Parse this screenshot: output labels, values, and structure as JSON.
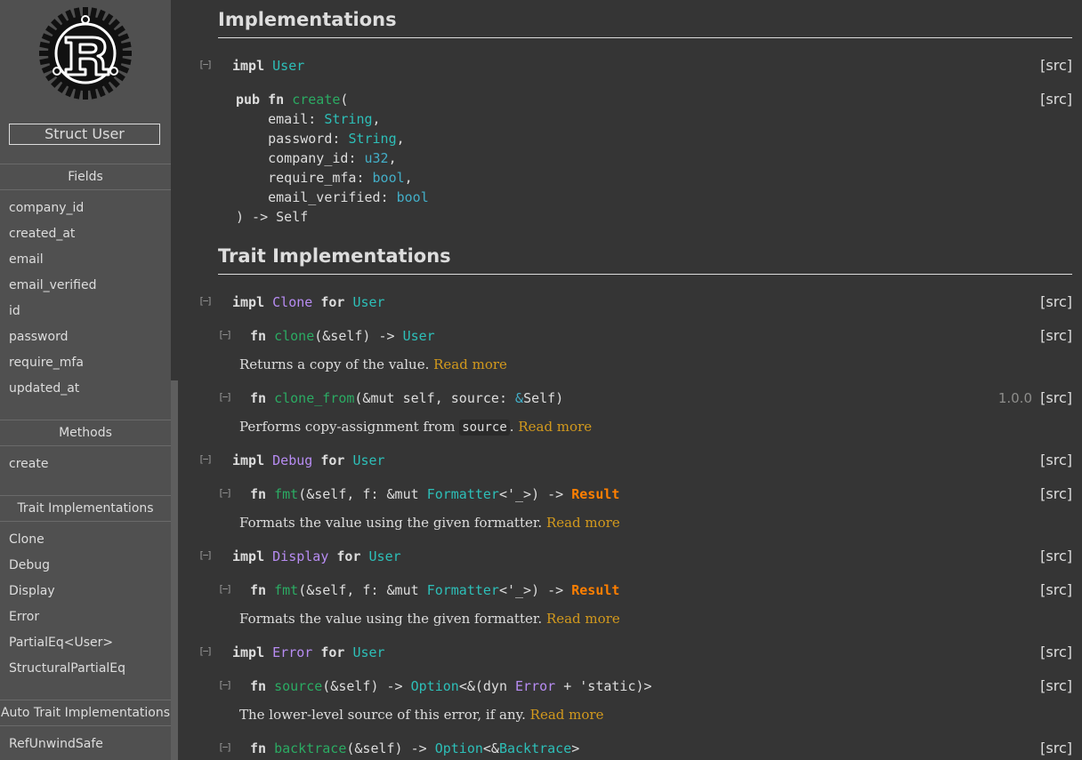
{
  "sidebar": {
    "location": "Struct User",
    "sections": {
      "fields_heading": "Fields",
      "fields": [
        "company_id",
        "created_at",
        "email",
        "email_verified",
        "id",
        "password",
        "require_mfa",
        "updated_at"
      ],
      "methods_heading": "Methods",
      "methods": [
        "create"
      ],
      "trait_impls_heading": "Trait Implementations",
      "trait_impls": [
        "Clone",
        "Debug",
        "Display",
        "Error",
        "PartialEq<User>",
        "StructuralPartialEq"
      ],
      "auto_trait_heading": "Auto Trait Implementations",
      "auto_traits": [
        "RefUnwindSafe"
      ]
    }
  },
  "main": {
    "implementations_heading": "Implementations",
    "trait_impls_heading": "Trait Implementations",
    "src_label": "[src]",
    "impl_user": {
      "kw": "impl",
      "type": "User"
    },
    "create_sig": {
      "pub": "pub",
      "fn": "fn",
      "name": "create",
      "open": "(",
      "params": [
        {
          "name": "email",
          "type": "String"
        },
        {
          "name": "password",
          "type": "String"
        },
        {
          "name": "company_id",
          "type": "u32"
        },
        {
          "name": "require_mfa",
          "type": "bool"
        },
        {
          "name": "email_verified",
          "type": "bool"
        }
      ],
      "close": ") -> Self"
    },
    "clone_impl": {
      "impl": "impl",
      "trait": "Clone",
      "for": "for",
      "type": "User"
    },
    "clone_fn": {
      "fn": "fn",
      "name": "clone",
      "args": "(&self) -> ",
      "ret": "User"
    },
    "clone_doc": {
      "text": "Returns a copy of the value.",
      "more": "Read more"
    },
    "clone_from_fn": {
      "fn": "fn",
      "name": "clone_from",
      "args": "(&mut self, source: ",
      "amp": "&",
      "ret": "Self",
      "close": ")",
      "since": "1.0.0"
    },
    "clone_from_doc": {
      "text": "Performs copy-assignment from ",
      "code": "source",
      "dot": ".",
      "more": "Read more"
    },
    "debug_impl": {
      "impl": "impl",
      "trait": "Debug",
      "for": "for",
      "type": "User"
    },
    "fmt_fn": {
      "fn": "fn",
      "name": "fmt",
      "args1": "(&self, f: &mut ",
      "formatter": "Formatter",
      "args2": "<'_>) -> ",
      "result": "Result"
    },
    "fmt_doc": {
      "text": "Formats the value using the given formatter.",
      "more": "Read more"
    },
    "display_impl": {
      "impl": "impl",
      "trait": "Display",
      "for": "for",
      "type": "User"
    },
    "error_impl": {
      "impl": "impl",
      "trait": "Error",
      "for": "for",
      "type": "User"
    },
    "source_fn": {
      "fn": "fn",
      "name": "source",
      "args": "(&self) -> ",
      "option": "Option",
      "mid": "<&(dyn ",
      "err": "Error",
      "end": " + 'static)>"
    },
    "source_doc": {
      "text": "The lower-level source of this error, if any.",
      "more": "Read more"
    },
    "backtrace_fn": {
      "fn": "fn",
      "name": "backtrace",
      "args": "(&self) -> ",
      "option": "Option",
      "mid": "<&",
      "bt": "Backtrace",
      "end": ">"
    }
  }
}
